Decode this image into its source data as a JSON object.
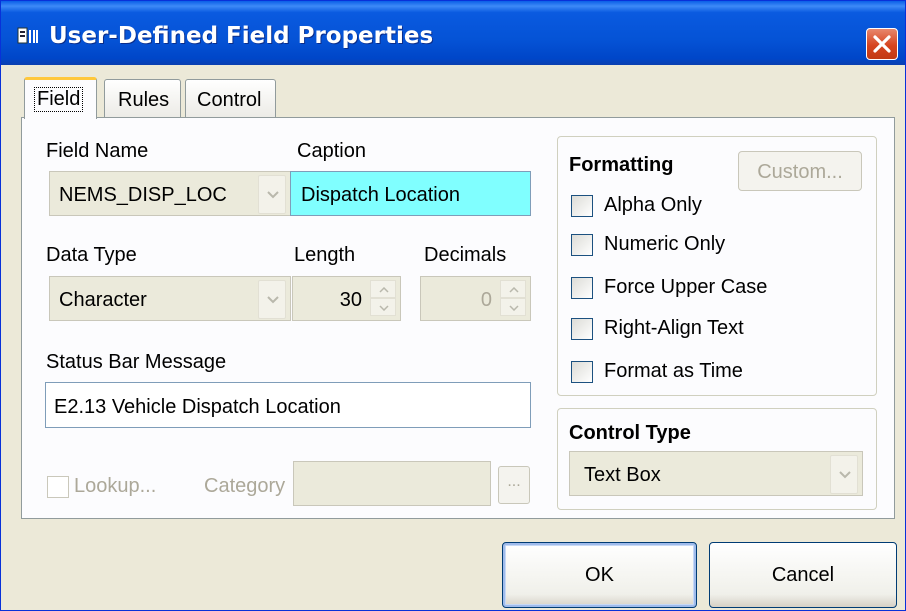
{
  "window": {
    "title": "User-Defined Field Properties"
  },
  "tabs": [
    {
      "label": "Field",
      "active": true
    },
    {
      "label": "Rules",
      "active": false
    },
    {
      "label": "Control",
      "active": false
    }
  ],
  "field": {
    "field_name_label": "Field Name",
    "field_name_value": "NEMS_DISP_LOC",
    "caption_label": "Caption",
    "caption_value": "Dispatch Location",
    "caption_bg": "#80ffff",
    "data_type_label": "Data Type",
    "data_type_value": "Character",
    "length_label": "Length",
    "length_value": "30",
    "decimals_label": "Decimals",
    "decimals_value": "0",
    "status_label": "Status Bar Message",
    "status_value": "E2.13 Vehicle Dispatch Location",
    "lookup_label": "Lookup...",
    "category_label": "Category",
    "category_value": "",
    "category_browse": "..."
  },
  "formatting": {
    "title": "Formatting",
    "custom_button": "Custom...",
    "options": [
      {
        "label": "Alpha Only",
        "checked": false
      },
      {
        "label": "Numeric Only",
        "checked": false
      },
      {
        "label": "Force Upper Case",
        "checked": false
      },
      {
        "label": "Right-Align Text",
        "checked": false
      },
      {
        "label": "Format as Time",
        "checked": false
      }
    ]
  },
  "control_type": {
    "title": "Control Type",
    "value": "Text Box"
  },
  "buttons": {
    "ok": "OK",
    "cancel": "Cancel"
  }
}
